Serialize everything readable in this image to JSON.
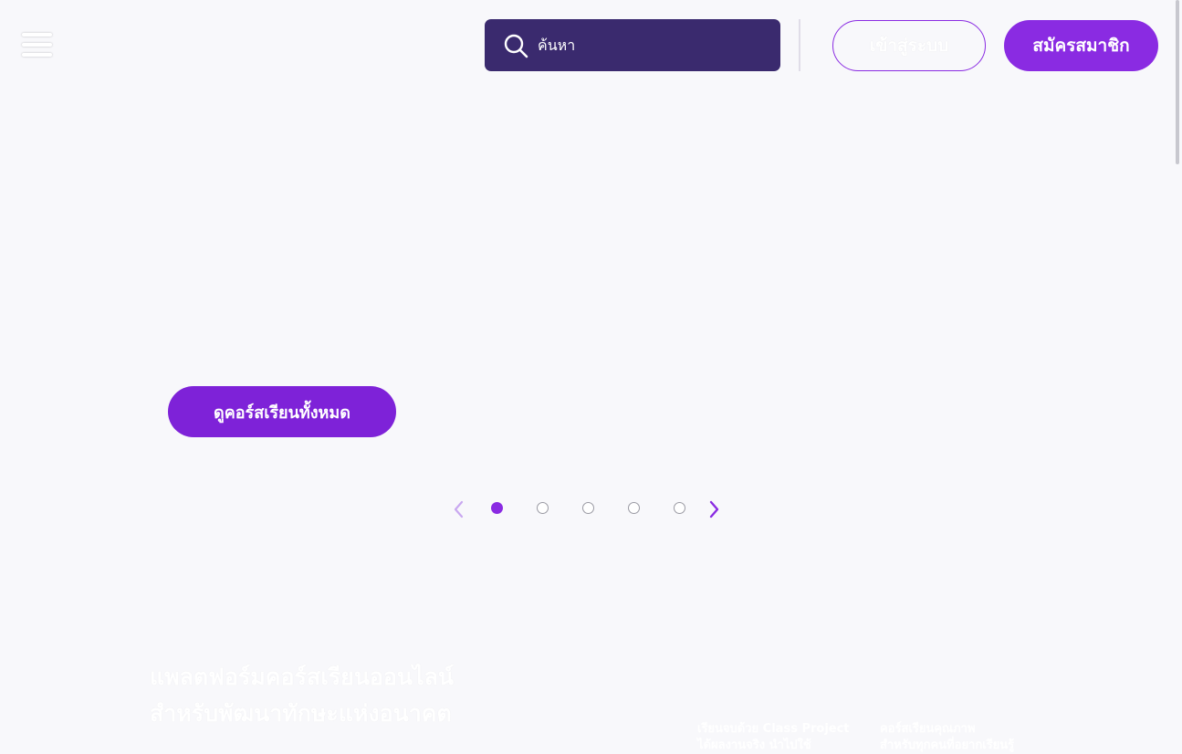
{
  "header": {
    "search_placeholder": "ค้นหา",
    "login_label": "เข้าสู่ระบบ",
    "signup_label": "สมัครสมาชิก"
  },
  "hero": {
    "cta_label": "ดูคอร์สเรียนทั้งหมด",
    "carousel": {
      "slide_count": 5,
      "active_index": 0
    }
  },
  "intro": {
    "tagline_line1": "แพลตฟอร์มคอร์สเรียนออนไลน์",
    "tagline_line2": "สำหรับพัฒนาทักษะแห่งอนาคต"
  },
  "features": [
    {
      "line1": "เรียนจบด้วย Class Project",
      "line2": "ได้ผลงานจริง นำไปใช้"
    },
    {
      "line1": "คอร์สเรียนคุณภาพ",
      "line2": "สำหรับทุกคนที่อยากเรียนรู้"
    }
  ],
  "colors": {
    "accent": "#8a2be2",
    "search_bg": "#3a2a6e",
    "page_bg": "#f8f8fb"
  },
  "icons": {
    "menu": "hamburger-icon",
    "search": "search-icon",
    "prev": "chevron-left-icon",
    "next": "chevron-right-icon"
  }
}
